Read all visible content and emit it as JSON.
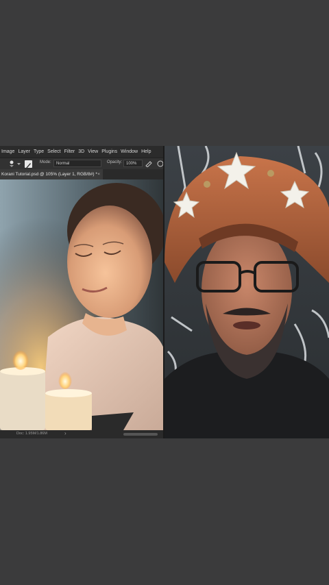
{
  "photoshop": {
    "menu": [
      "Image",
      "Layer",
      "Type",
      "Select",
      "Filter",
      "3D",
      "View",
      "Plugins",
      "Window",
      "Help"
    ],
    "options": {
      "mode_label": "Mode:",
      "mode_value": "Normal",
      "opacity_label": "Opacity:",
      "opacity_value": "100%"
    },
    "document_tab": "Korani Tutorial.psd @ 105% (Layer 1, RGB/8#) *",
    "document_tab_close": "×",
    "status": {
      "doc_info": "Doc: 1.95M/1.86M",
      "nav": "›"
    }
  },
  "colors": {
    "background": "#3b3b3c",
    "ps_ui": "#2b2b2b",
    "candle_glow": "#ffb347"
  },
  "icons": [
    "brush-tool-icon",
    "brush-preset-icon",
    "brush-settings-icon",
    "airbrush-icon",
    "pressure-icon",
    "close-icon"
  ]
}
